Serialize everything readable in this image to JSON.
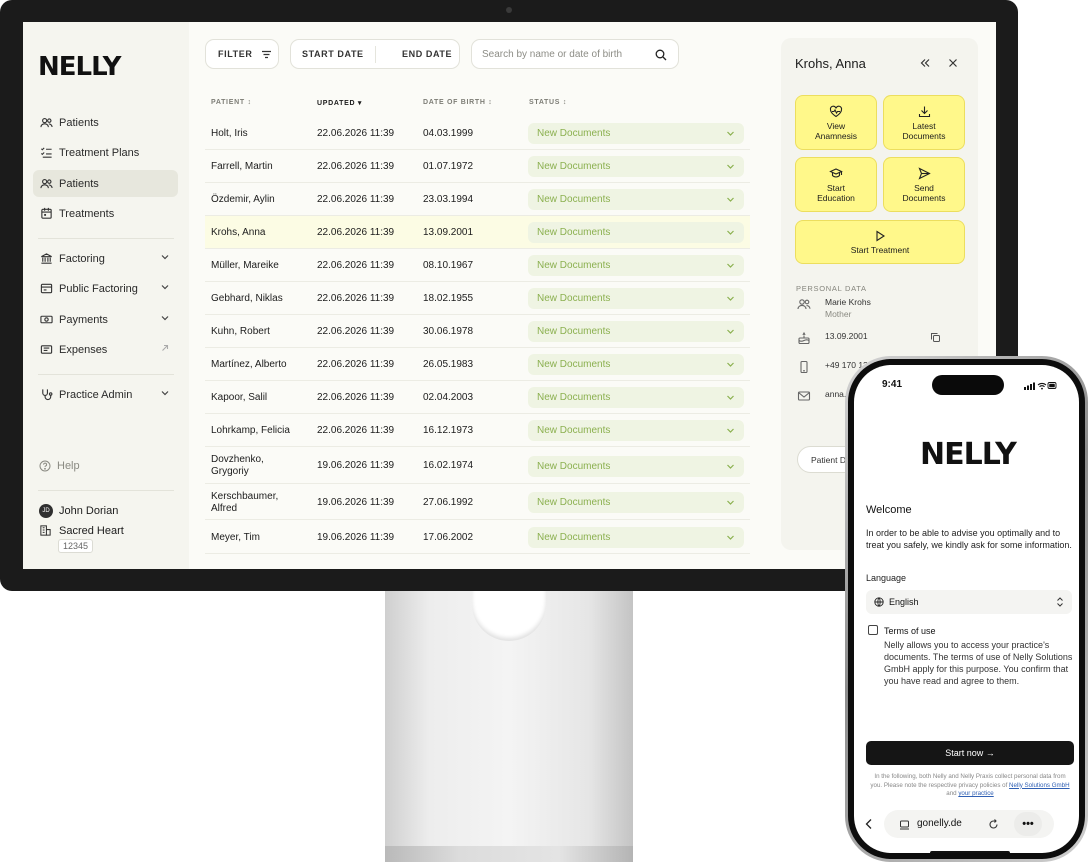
{
  "app": {
    "logo": "NELLY"
  },
  "sidebar": {
    "items": [
      {
        "label": "Patients"
      },
      {
        "label": "Treatment Plans"
      },
      {
        "label": "Patients"
      },
      {
        "label": "Treatments"
      },
      {
        "label": "Factoring"
      },
      {
        "label": "Public Factoring"
      },
      {
        "label": "Payments"
      },
      {
        "label": "Expenses"
      },
      {
        "label": "Practice Admin"
      }
    ],
    "help": "Help",
    "user": {
      "initials": "JD",
      "name": "John Dorian",
      "practice": "Sacred Heart",
      "code": "12345"
    }
  },
  "toolbar": {
    "filter": "FILTER",
    "start_date": "START DATE",
    "end_date": "END DATE",
    "search_placeholder": "Search by name or date of birth"
  },
  "table": {
    "headers": {
      "patient": "PATIENT",
      "updated": "UPDATED",
      "dob": "DATE OF BIRTH",
      "status": "STATUS"
    },
    "rows": [
      {
        "name": "Holt, Iris",
        "updated": "22.06.2026 11:39",
        "dob": "04.03.1999",
        "status": "New Documents"
      },
      {
        "name": "Farrell, Martin",
        "updated": "22.06.2026 11:39",
        "dob": "01.07.1972",
        "status": "New Documents"
      },
      {
        "name": "Özdemir, Aylin",
        "updated": "22.06.2026 11:39",
        "dob": "23.03.1994",
        "status": "New Documents"
      },
      {
        "name": "Krohs, Anna",
        "updated": "22.06.2026 11:39",
        "dob": "13.09.2001",
        "status": "New Documents"
      },
      {
        "name": "Müller, Mareike",
        "updated": "22.06.2026 11:39",
        "dob": "08.10.1967",
        "status": "New Documents"
      },
      {
        "name": "Gebhard, Niklas",
        "updated": "22.06.2026 11:39",
        "dob": "18.02.1955",
        "status": "New Documents"
      },
      {
        "name": "Kuhn, Robert",
        "updated": "22.06.2026 11:39",
        "dob": "30.06.1978",
        "status": "New Documents"
      },
      {
        "name": "Martínez, Alberto",
        "updated": "22.06.2026 11:39",
        "dob": "26.05.1983",
        "status": "New Documents"
      },
      {
        "name": "Kapoor, Salil",
        "updated": "22.06.2026 11:39",
        "dob": "02.04.2003",
        "status": "New Documents"
      },
      {
        "name": "Lohrkamp, Felicia",
        "updated": "22.06.2026 11:39",
        "dob": "16.12.1973",
        "status": "New Documents"
      },
      {
        "name": "Dovzhenko, Grygoriy",
        "updated": "19.06.2026 11:39",
        "dob": "16.02.1974",
        "status": "New Documents"
      },
      {
        "name": "Kerschbaumer, Alfred",
        "updated": "19.06.2026 11:39",
        "dob": "27.06.1992",
        "status": "New Documents"
      },
      {
        "name": "Meyer, Tim",
        "updated": "19.06.2026 11:39",
        "dob": "17.06.2002",
        "status": "New Documents"
      }
    ]
  },
  "panel": {
    "title": "Krohs, Anna",
    "actions": {
      "view_anamnesis": "View Anamnesis",
      "latest_documents": "Latest Documents",
      "start_education": "Start Education",
      "send_documents": "Send Documents",
      "start_treatment": "Start Treatment"
    },
    "personal_data_label": "PERSONAL DATA",
    "contact_name": "Marie Krohs",
    "contact_role": "Mother",
    "birthdate": "13.09.2001",
    "phone": "+49 170 12",
    "email": "anna.",
    "patient_button": "Patient D"
  },
  "phone": {
    "time": "9:41",
    "logo": "NELLY",
    "title": "Welcome",
    "intro": "In order to be able to advise you optimally and to treat you safely, we kindly ask for some information.",
    "language_label": "Language",
    "language_value": "English",
    "terms_title": "Terms of use",
    "terms_text": "Nelly allows you to access your practice's documents. The terms of use of Nelly Solutions GmbH apply for this purpose. You confirm that you have read and agree to them.",
    "start_button": "Start now →",
    "privacy_text": "In the following, both Nelly and Nelly Praxis collect personal data from you. Please note the respective privacy policies of",
    "privacy_link1": "Nelly Solutions GmbH",
    "privacy_and": "and",
    "privacy_link2": "your practice",
    "url": "gonelly.de"
  },
  "colors": {
    "accent_yellow": "#fff88a",
    "status_green": "#8bb04f",
    "status_bg": "#eff4e3",
    "highlight_row": "#fcfce4"
  }
}
